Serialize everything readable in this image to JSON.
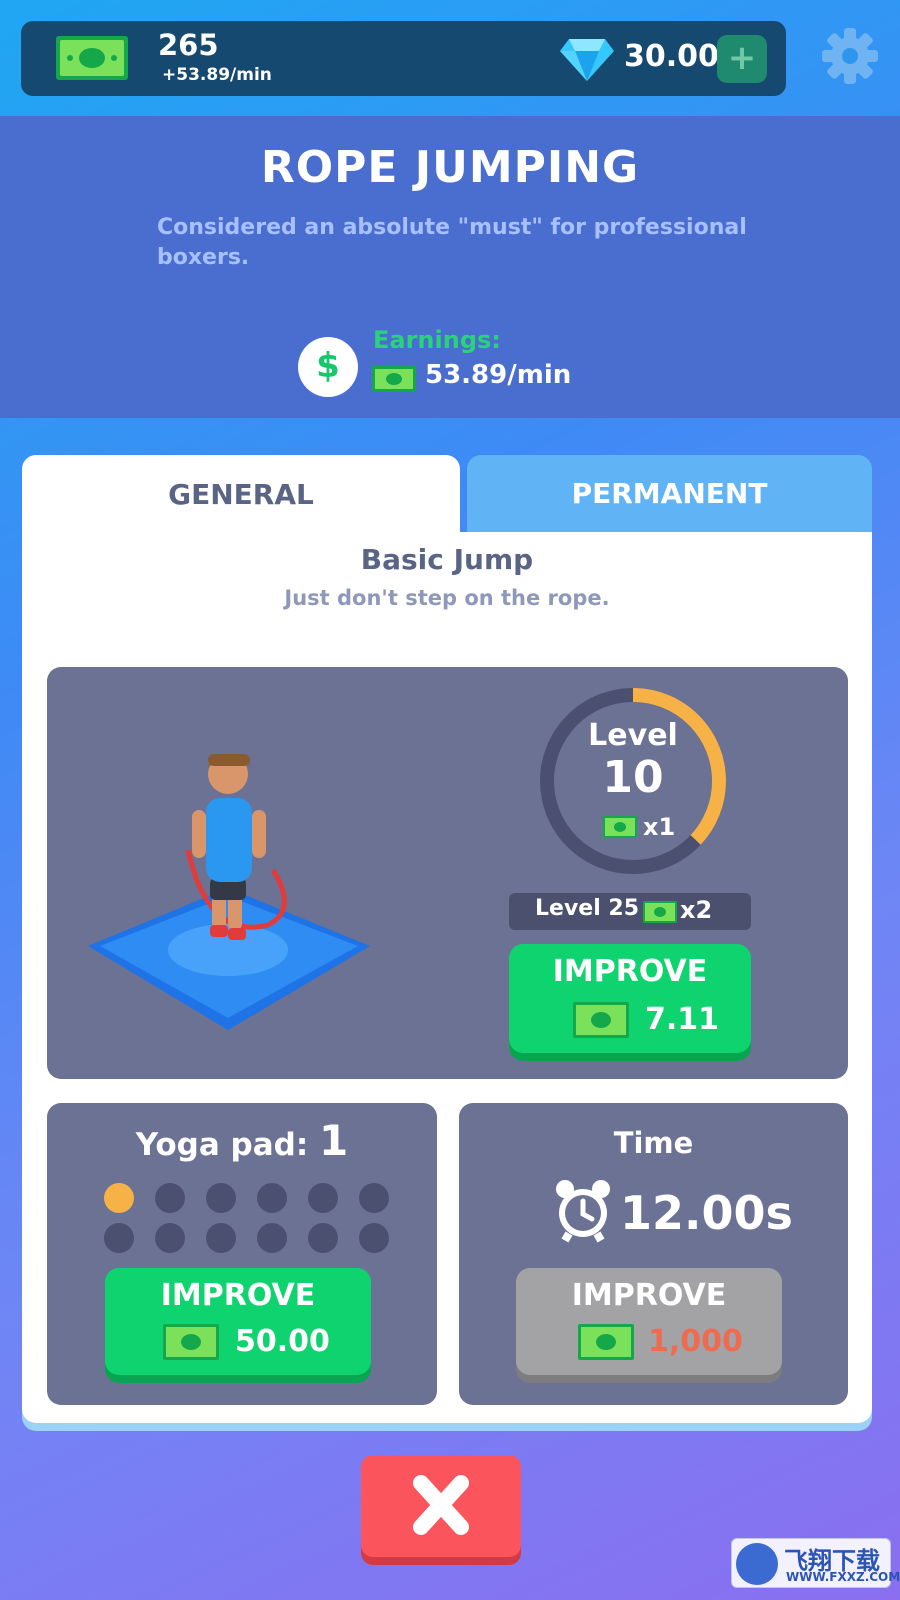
{
  "topbar": {
    "cash_amount": "265",
    "cash_rate": "+53.89/min",
    "gem_amount": "30.00",
    "gem_add_label": "+"
  },
  "header": {
    "title": "ROPE JUMPING",
    "description": "Considered an absolute \"must\" for professional boxers.",
    "earnings_label": "Earnings:",
    "earnings_symbol": "$",
    "earnings_value": "53.89/min"
  },
  "tabs": [
    {
      "label": "GENERAL",
      "active": true
    },
    {
      "label": "PERMANENT",
      "active": false
    }
  ],
  "skill": {
    "name": "Basic Jump",
    "description": "Just don't step on the rope."
  },
  "level": {
    "label": "Level",
    "value": "10",
    "multiplier": "x1",
    "progress_fraction": 0.37,
    "next_label": "Level 25",
    "next_multiplier": "x2"
  },
  "improve_main": {
    "label": "IMPROVE",
    "price": "7.11"
  },
  "yoga": {
    "label": "Yoga pad:",
    "value": "1",
    "dots_filled": 1,
    "dots_total": 12,
    "improve_label": "IMPROVE",
    "improve_price": "50.00"
  },
  "time": {
    "label": "Time",
    "value": "12.00s",
    "improve_label": "IMPROVE",
    "improve_price": "1,000",
    "improve_disabled": true
  },
  "close_label": "✖",
  "watermark": {
    "cn": "飞翔下载",
    "url": "WWW.FXXZ.COM"
  },
  "colors": {
    "topbar_bg": "#16496f",
    "header_bg": "#4a6dd0",
    "panel_bg": "#6b7294",
    "green_button": "#0ed36e",
    "gray_button": "#a3a3a6",
    "close_button": "#fb545d",
    "level_progress": "#f6b247",
    "earnings_green": "#2ad27a",
    "price_red": "#ef6a4f"
  },
  "icons": [
    "cash-icon",
    "gem-icon",
    "settings-gear-icon",
    "dollar-icon",
    "alarm-clock-icon",
    "close-icon"
  ]
}
